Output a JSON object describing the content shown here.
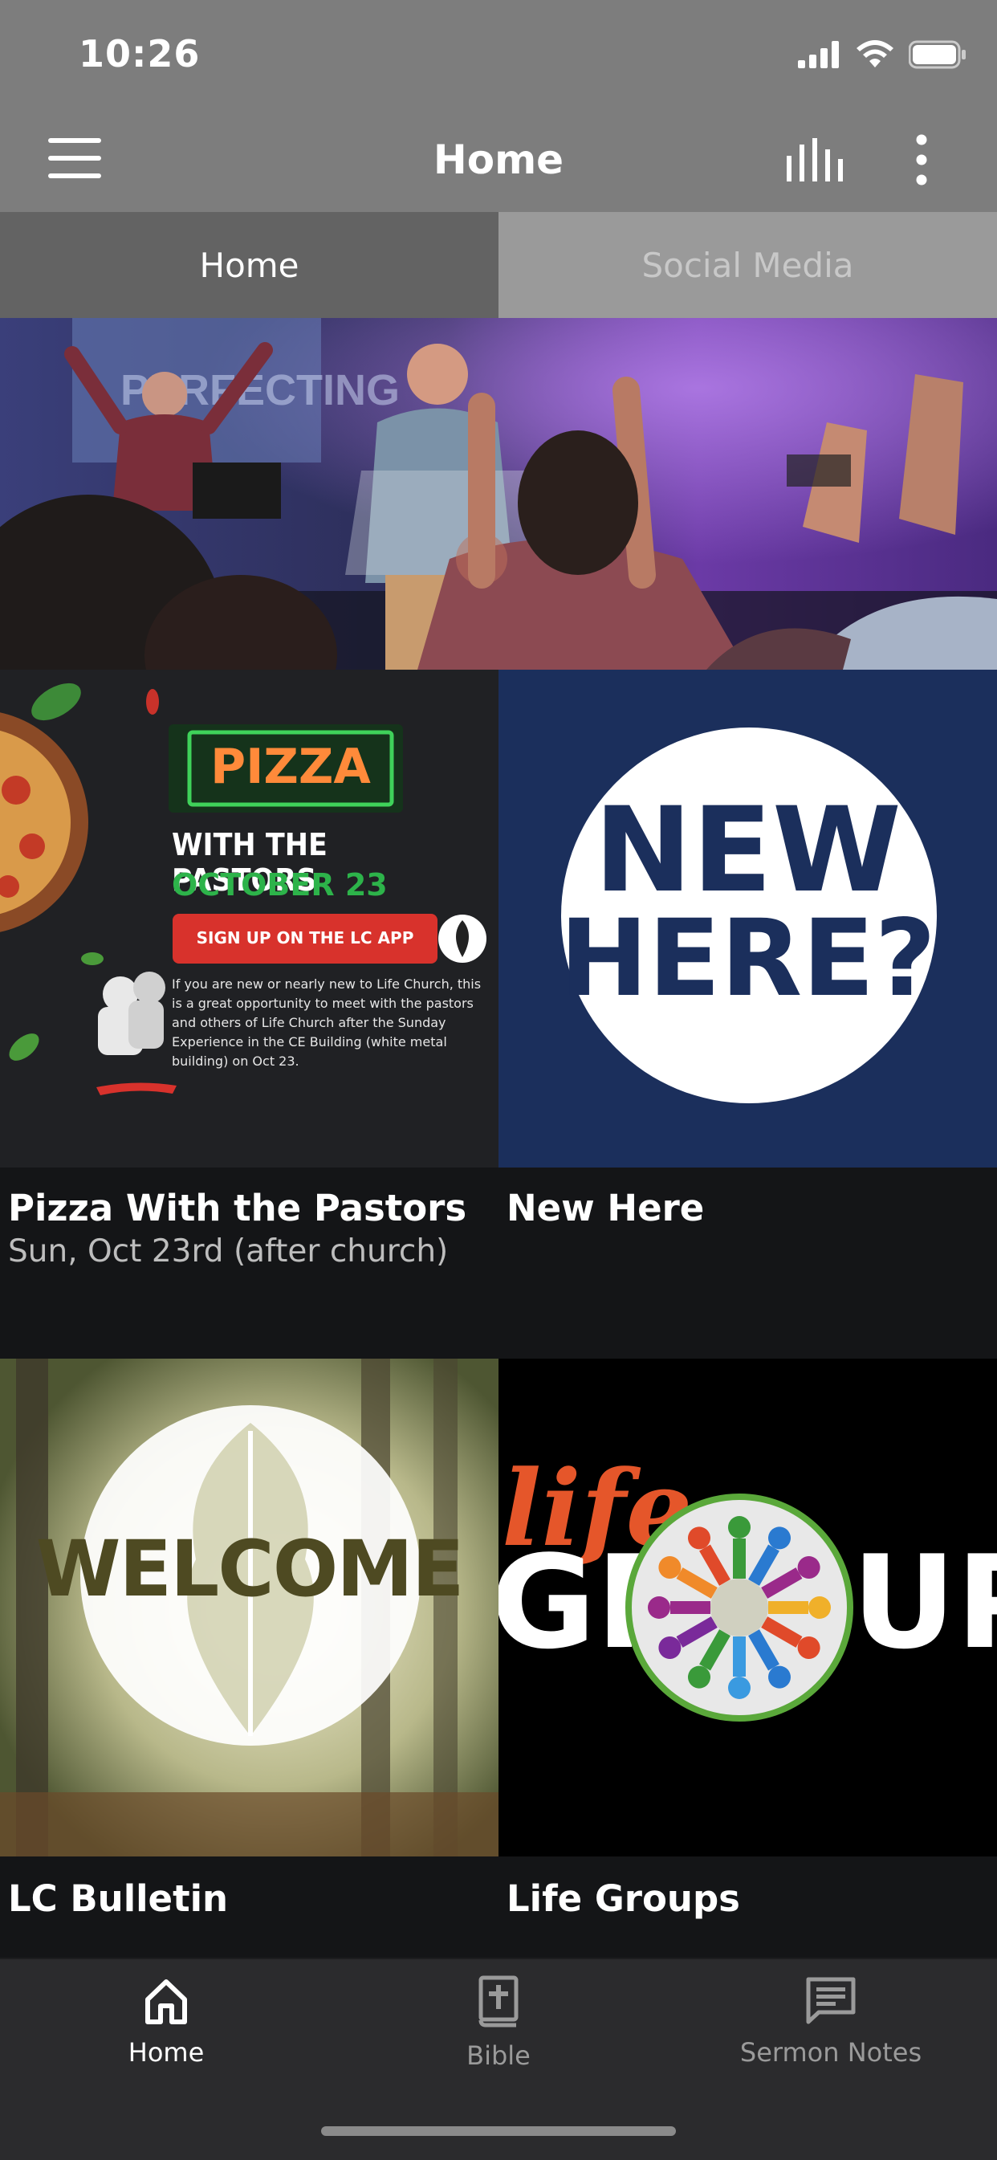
{
  "status_bar": {
    "time": "10:26"
  },
  "nav": {
    "title": "Home"
  },
  "tabs": [
    {
      "label": "Home",
      "active": true
    },
    {
      "label": "Social Media",
      "active": false
    }
  ],
  "tiles": [
    {
      "title": "Pizza With the Pastors",
      "subtitle": "Sun, Oct 23rd (after church)",
      "art": {
        "sign": "PIZZA",
        "line1": "WITH THE PASTORS",
        "line2": "OCTOBER 23",
        "button": "SIGN UP ON THE LC APP",
        "body": "If you are new or nearly new to Life Church, this is a great opportunity to meet with the pastors and others of Life Church after the Sunday Experience in the CE Building (white metal building) on Oct 23."
      }
    },
    {
      "title": "New Here",
      "art": {
        "line1": "NEW",
        "line2": "HERE?"
      }
    },
    {
      "title": "LC Bulletin",
      "art": {
        "word": "WELCOME"
      }
    },
    {
      "title": "Life Groups",
      "art": {
        "script": "life",
        "word": "GR",
        "word2": "UP"
      }
    }
  ],
  "hero": {
    "banner_text": "PERFECTING"
  },
  "bottom_nav": [
    {
      "label": "Home",
      "icon": "home-icon",
      "active": true
    },
    {
      "label": "Bible",
      "icon": "bible-icon",
      "active": false
    },
    {
      "label": "Sermon Notes",
      "icon": "notes-icon",
      "active": false
    }
  ],
  "colors": {
    "header_bg": "#7d7d7d",
    "tab_active_bg": "#636363",
    "tab_inactive_bg": "#9a9a9a",
    "content_bg": "#141517",
    "bottom_nav_bg": "#2b2b2d",
    "pizza_red": "#d8322c",
    "pizza_green": "#2db34a",
    "new_here_blue": "#1b2f5c",
    "life_orange": "#e5562a"
  }
}
